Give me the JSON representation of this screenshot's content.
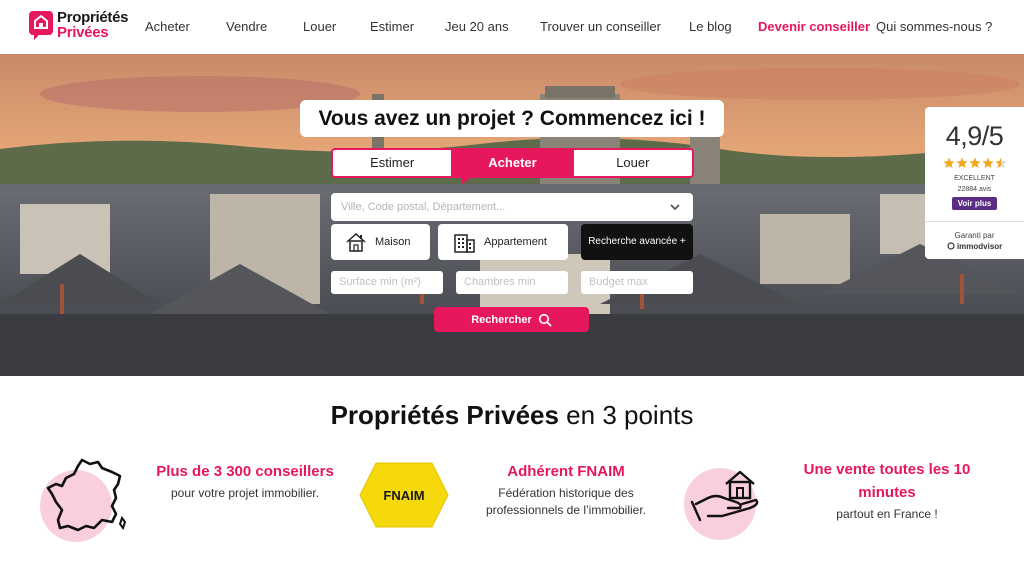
{
  "brand": {
    "line1": "Propriétés",
    "line2": "Privées"
  },
  "nav": {
    "items": [
      "Acheter",
      "Vendre",
      "Louer",
      "Estimer",
      "Jeu 20 ans",
      "Trouver un conseiller",
      "Le blog",
      "Devenir conseiller",
      "Qui sommes-nous ?"
    ]
  },
  "hero": {
    "headline": "Vous avez un projet ? Commencez ici !",
    "tabs": [
      "Estimer",
      "Acheter",
      "Louer"
    ],
    "active_tab": "Acheter",
    "city_placeholder": "Ville, Code postal, Département...",
    "type_maison": "Maison",
    "type_appartement": "Appartement",
    "advanced": "Recherche avancée +",
    "surface_placeholder": "Surface min (m²)",
    "chambres_placeholder": "Chambres min",
    "budget_placeholder": "Budget max",
    "search_label": "Rechercher"
  },
  "rating": {
    "score": "4,9/5",
    "stars": 4.5,
    "label": "EXCELLENT",
    "count": "22884 avis",
    "voir": "Voir plus",
    "garanti": "Garanti par",
    "provider": "immodvisor"
  },
  "points": {
    "title_bold": "Propriétés Privées",
    "title_rest": " en 3 points",
    "p1_title": "Plus de 3 300 conseillers",
    "p1_desc": "pour votre projet immobilier.",
    "p2_logo": "FNAIM",
    "p2_title": "Adhérent FNAIM",
    "p2_desc1": "Fédération historique des",
    "p2_desc2": "professionnels de l’immobilier.",
    "p3_title1": "Une vente toutes les 10",
    "p3_title2": "minutes",
    "p3_desc": "partout en France !"
  },
  "colors": {
    "accent": "#e6175c",
    "dark": "#111111",
    "pink_light": "#f8cfdb",
    "fnaim_yellow": "#f5d90a",
    "immodvisor": "#5b2d82"
  }
}
